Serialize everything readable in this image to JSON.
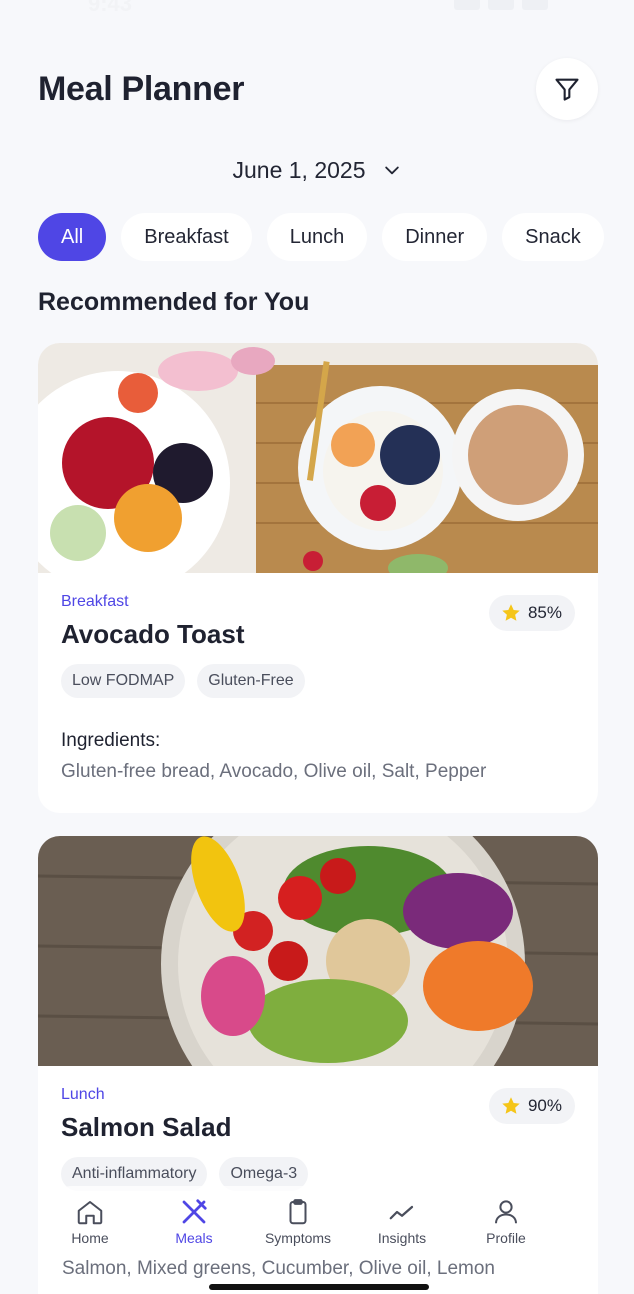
{
  "header": {
    "title": "Meal Planner"
  },
  "date": {
    "label": "June 1, 2025"
  },
  "filters": [
    {
      "label": "All",
      "active": true
    },
    {
      "label": "Breakfast",
      "active": false
    },
    {
      "label": "Lunch",
      "active": false
    },
    {
      "label": "Dinner",
      "active": false
    },
    {
      "label": "Snack",
      "active": false
    }
  ],
  "section": {
    "title": "Recommended for You"
  },
  "meals": [
    {
      "type": "Breakfast",
      "name": "Avocado Toast",
      "score": "85%",
      "tags": [
        "Low FODMAP",
        "Gluten-Free"
      ],
      "ingredients_label": "Ingredients:",
      "ingredients": "Gluten-free bread, Avocado, Olive oil, Salt, Pepper"
    },
    {
      "type": "Lunch",
      "name": "Salmon Salad",
      "score": "90%",
      "tags": [
        "Anti-inflammatory",
        "Omega-3"
      ],
      "ingredients": "Salmon, Mixed greens, Cucumber, Olive oil, Lemon"
    }
  ],
  "nav": [
    {
      "label": "Home",
      "icon": "home-icon",
      "active": false
    },
    {
      "label": "Meals",
      "icon": "utensils-icon",
      "active": true
    },
    {
      "label": "Symptoms",
      "icon": "clipboard-icon",
      "active": false
    },
    {
      "label": "Insights",
      "icon": "trend-icon",
      "active": false
    },
    {
      "label": "Profile",
      "icon": "user-icon",
      "active": false
    }
  ],
  "colors": {
    "accent": "#4f46e5",
    "background": "#f7f8fb",
    "star": "#f5c518"
  }
}
